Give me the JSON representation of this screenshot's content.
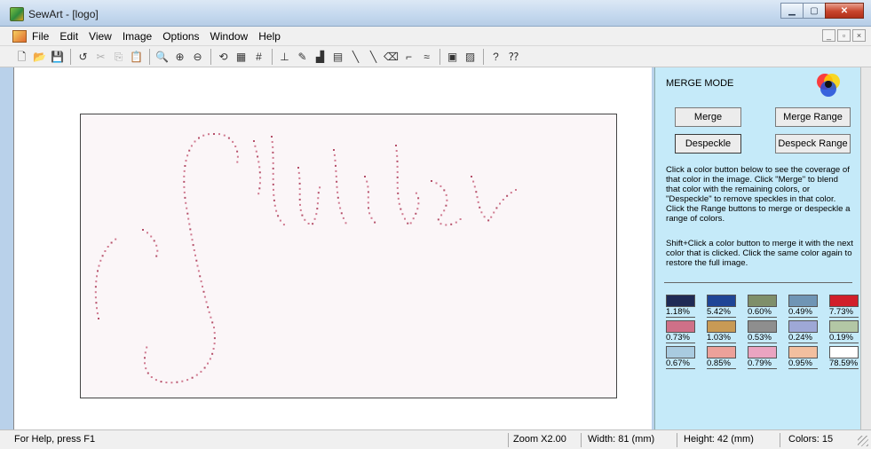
{
  "window": {
    "title": "SewArt - [logo]"
  },
  "menu": [
    "File",
    "Edit",
    "View",
    "Image",
    "Options",
    "Window",
    "Help"
  ],
  "toolbar": {
    "buttons": [
      {
        "name": "new-icon",
        "glyph": "🗋"
      },
      {
        "name": "open-icon",
        "glyph": "📂"
      },
      {
        "name": "save-icon",
        "glyph": "💾"
      },
      {
        "name": "sep"
      },
      {
        "name": "undo-icon",
        "glyph": "↺"
      },
      {
        "name": "cut-icon",
        "glyph": "✂",
        "disabled": true
      },
      {
        "name": "copy-icon",
        "glyph": "⎘",
        "disabled": true
      },
      {
        "name": "paste-icon",
        "glyph": "📋"
      },
      {
        "name": "sep"
      },
      {
        "name": "zoom-icon",
        "glyph": "🔍"
      },
      {
        "name": "zoom-in-icon",
        "glyph": "⊕"
      },
      {
        "name": "zoom-out-icon",
        "glyph": "⊖"
      },
      {
        "name": "sep"
      },
      {
        "name": "rotate-icon",
        "glyph": "⟲"
      },
      {
        "name": "crop-icon",
        "glyph": "▦"
      },
      {
        "name": "grid-icon",
        "glyph": "#"
      },
      {
        "name": "sep"
      },
      {
        "name": "stamp-icon",
        "glyph": "⊥"
      },
      {
        "name": "wand-icon",
        "glyph": "✎"
      },
      {
        "name": "bucket-icon",
        "glyph": "▟"
      },
      {
        "name": "palette-icon",
        "glyph": "▤"
      },
      {
        "name": "pencil-icon",
        "glyph": "╲"
      },
      {
        "name": "line-icon",
        "glyph": "╲"
      },
      {
        "name": "eraser-icon",
        "glyph": "⌫"
      },
      {
        "name": "dropper-icon",
        "glyph": "⌐"
      },
      {
        "name": "thread-icon",
        "glyph": "≈"
      },
      {
        "name": "sep"
      },
      {
        "name": "sew-icon",
        "glyph": "▣"
      },
      {
        "name": "export-icon",
        "glyph": "▨"
      },
      {
        "name": "sep"
      },
      {
        "name": "help-icon",
        "glyph": "?"
      },
      {
        "name": "context-help-icon",
        "glyph": "⁇"
      }
    ]
  },
  "panel": {
    "mode_title": "MERGE MODE",
    "buttons": {
      "merge": "Merge",
      "merge_range": "Merge Range",
      "despeckle": "Despeckle",
      "despeck_range": "Despeck Range"
    },
    "help1": "Click a color button below to see the coverage of that color in the image. Click \"Merge\" to blend that color with the remaining colors, or \"Despeckle\" to remove speckles in that color. Click the Range buttons to merge or despeckle a range of colors.",
    "help2": "Shift+Click a color button to merge it with the next color that is clicked. Click the same color again to restore the full image.",
    "swatches": [
      {
        "color": "#1f2a55",
        "pct": "1.18%"
      },
      {
        "color": "#1f4596",
        "pct": "5.42%"
      },
      {
        "color": "#7f8f6a",
        "pct": "0.60%"
      },
      {
        "color": "#6f95b5",
        "pct": "0.49%"
      },
      {
        "color": "#d11f2a",
        "pct": "7.73%"
      },
      {
        "color": "#cf7088",
        "pct": "0.73%"
      },
      {
        "color": "#c89a55",
        "pct": "1.03%"
      },
      {
        "color": "#8e8e8e",
        "pct": "0.53%"
      },
      {
        "color": "#9ea8d6",
        "pct": "0.24%"
      },
      {
        "color": "#b3c7a5",
        "pct": "0.19%"
      },
      {
        "color": "#a9cbe0",
        "pct": "0.67%"
      },
      {
        "color": "#eca19a",
        "pct": "0.85%"
      },
      {
        "color": "#eaa4c1",
        "pct": "0.79%"
      },
      {
        "color": "#f2bf9f",
        "pct": "0.95%"
      },
      {
        "color": "#ffffff",
        "pct": "78.59%"
      }
    ]
  },
  "status": {
    "help": "For Help, press F1",
    "zoom": "Zoom X2.00",
    "width": "Width: 81 (mm)",
    "height": "Height: 42 (mm)",
    "colors": "Colors: 15"
  }
}
